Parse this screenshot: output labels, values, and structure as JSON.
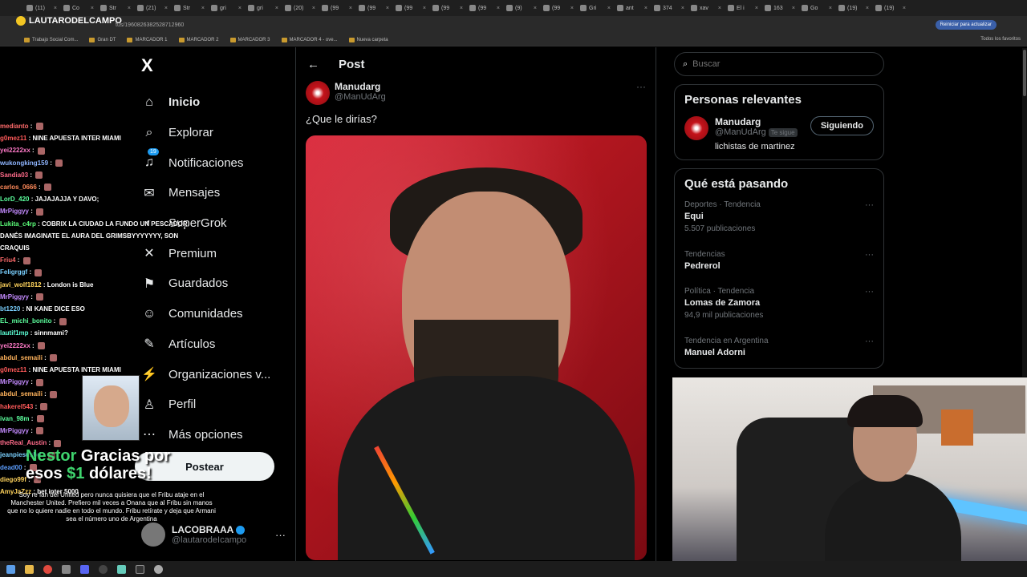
{
  "browser": {
    "tabs": [
      "(11)",
      "Co",
      "Str",
      "(21)",
      "Str",
      "gri",
      "gri",
      "(20)",
      "(99",
      "(99",
      "(99",
      "(99",
      "(99",
      "(9)",
      "(99",
      "Gri",
      "ant",
      "374",
      "xav",
      "El i",
      "163",
      "Go",
      "(19)",
      "(19)"
    ],
    "url": "tus/1960826382528712960",
    "update_button": "Reiniciar para actualizar",
    "bookmarks": [
      "Trabajo Social Com...",
      "Gran DT",
      "MARCADOR 1",
      "MARCADOR 2",
      "MARCADOR 3",
      "MARCADOR 4 - ove...",
      "Nueva carpeta"
    ],
    "all_bookmarks": "Todos los favoritos"
  },
  "sidebar": {
    "logo": "X",
    "notifications_badge": "19",
    "items": [
      {
        "label": "Inicio",
        "icon": "home-icon"
      },
      {
        "label": "Explorar",
        "icon": "search-icon"
      },
      {
        "label": "Notificaciones",
        "icon": "bell-icon"
      },
      {
        "label": "Mensajes",
        "icon": "mail-icon"
      },
      {
        "label": "SuperGrok",
        "icon": "grok-icon"
      },
      {
        "label": "Premium",
        "icon": "x-icon"
      },
      {
        "label": "Guardados",
        "icon": "bookmark-icon"
      },
      {
        "label": "Comunidades",
        "icon": "people-icon"
      },
      {
        "label": "Artículos",
        "icon": "article-icon"
      },
      {
        "label": "Organizaciones v...",
        "icon": "lightning-icon"
      },
      {
        "label": "Perfil",
        "icon": "person-icon"
      },
      {
        "label": "Más opciones",
        "icon": "more-circle-icon"
      }
    ],
    "post_button": "Postear",
    "account": {
      "name": "LACOBRAAA",
      "handle": "@lautarodeIcampo"
    }
  },
  "main": {
    "header": "Post",
    "author": {
      "name": "Manudarg",
      "handle": "@ManUdArg"
    },
    "text": "¿Que le dirías?"
  },
  "right": {
    "search_placeholder": "Buscar",
    "relevant": {
      "title": "Personas relevantes",
      "name": "Manudarg",
      "handle": "@ManUdArg",
      "follows_you": "Te sigue",
      "bio": "lichistas de martinez",
      "button": "Siguiendo"
    },
    "trends_title": "Qué está pasando",
    "trends": [
      {
        "context": "Deportes · Tendencia",
        "name": "Equi",
        "count": "5.507 publicaciones"
      },
      {
        "context": "Tendencias",
        "name": "Pedrerol",
        "count": ""
      },
      {
        "context": "Política · Tendencia",
        "name": "Lomas de Zamora",
        "count": "94,9 mil publicaciones"
      },
      {
        "context": "Tendencia en Argentina",
        "name": "Manuel Adorni",
        "count": ""
      }
    ]
  },
  "stream": {
    "channel": "LAUTARODELCAMPO",
    "chat": [
      {
        "user": "medianto",
        "msg": "",
        "color": "#ff6b6b"
      },
      {
        "user": "g0mez11",
        "msg": "NINE APUESTA INTER MIAMI",
        "color": "#ff5a5a"
      },
      {
        "user": "yei2222xx",
        "msg": "",
        "color": "#ff7ac8"
      },
      {
        "user": "wukongking159",
        "msg": "",
        "color": "#8fb5ff"
      },
      {
        "user": "Sandia03",
        "msg": "",
        "color": "#ff6b8a"
      },
      {
        "user": "carlos_0666",
        "msg": "",
        "color": "#ff8a5a"
      },
      {
        "user": "LorD_420",
        "msg": "JAJAJAJJA Y DAVO;",
        "color": "#5cff9d"
      },
      {
        "user": "MrPiggyy",
        "msg": "",
        "color": "#c48bff"
      },
      {
        "user": "Lukita_c4rp",
        "msg": "COBRIX LA CIUDAD LA FUNDO UN PESCADOR",
        "color": "#5cff7a"
      },
      {
        "user": "",
        "msg": "DANÉS IMAGINATE EL AURA DEL GRIMSBYYYYYYY, SON",
        "color": "#ffffff"
      },
      {
        "user": "",
        "msg": "CRAQUIS",
        "color": "#ffffff"
      },
      {
        "user": "Friu4",
        "msg": "",
        "color": "#ff6b6b"
      },
      {
        "user": "Feligrggf",
        "msg": "",
        "color": "#7ad0ff"
      },
      {
        "user": "javi_wolf1812",
        "msg": "London is Blue",
        "color": "#ffd35c"
      },
      {
        "user": "MrPiggyy",
        "msg": "",
        "color": "#c48bff"
      },
      {
        "user": "bt1220",
        "msg": "NI KANE DICE ESO",
        "color": "#7ad0ff"
      },
      {
        "user": "EL_michi_bonito",
        "msg": "",
        "color": "#5cff9d"
      },
      {
        "user": "lautif1mp",
        "msg": "sinnmami?",
        "color": "#5cffd6"
      },
      {
        "user": "yei2222xx",
        "msg": "",
        "color": "#ff7ac8"
      },
      {
        "user": "abdul_semaili",
        "msg": "",
        "color": "#ffb35c"
      },
      {
        "user": "g0mez11",
        "msg": "NINE APUESTA INTER MIAMI",
        "color": "#ff5a5a"
      },
      {
        "user": "MrPiggyy",
        "msg": "",
        "color": "#c48bff"
      },
      {
        "user": "abdul_semaili",
        "msg": "",
        "color": "#ffb35c"
      },
      {
        "user": "hakerel543",
        "msg": "",
        "color": "#ff5a5a"
      },
      {
        "user": "ivan_98m",
        "msg": "",
        "color": "#5cff9d"
      },
      {
        "user": "MrPiggyy",
        "msg": "",
        "color": "#c48bff"
      },
      {
        "user": "theReal_Austin",
        "msg": "",
        "color": "#ff6b8a"
      },
      {
        "user": "jeanpiesusbd",
        "msg": "",
        "color": "#7ad0ff"
      },
      {
        "user": "dead00",
        "msg": "",
        "color": "#5c9eff"
      },
      {
        "user": "diego99f",
        "msg": "",
        "color": "#ffd35c"
      },
      {
        "user": "AmyJaZzz",
        "msg": "bet inter 5000",
        "color": "#ffd35c"
      }
    ],
    "donation": {
      "name": "Nestor",
      "line1": "Gracias por",
      "line2a": "esos",
      "amount": "$1",
      "line2b": "dólares!",
      "message": "Soy re fan del United pero nunca quisiera que el Fribu ataje en el Manchester United. Prefiero mil veces a Onana que al Fribu sin manos que no lo quiere nadie en todo el mundo. Fribu retírate y deja que Armani sea el número uno de Argentina"
    }
  }
}
